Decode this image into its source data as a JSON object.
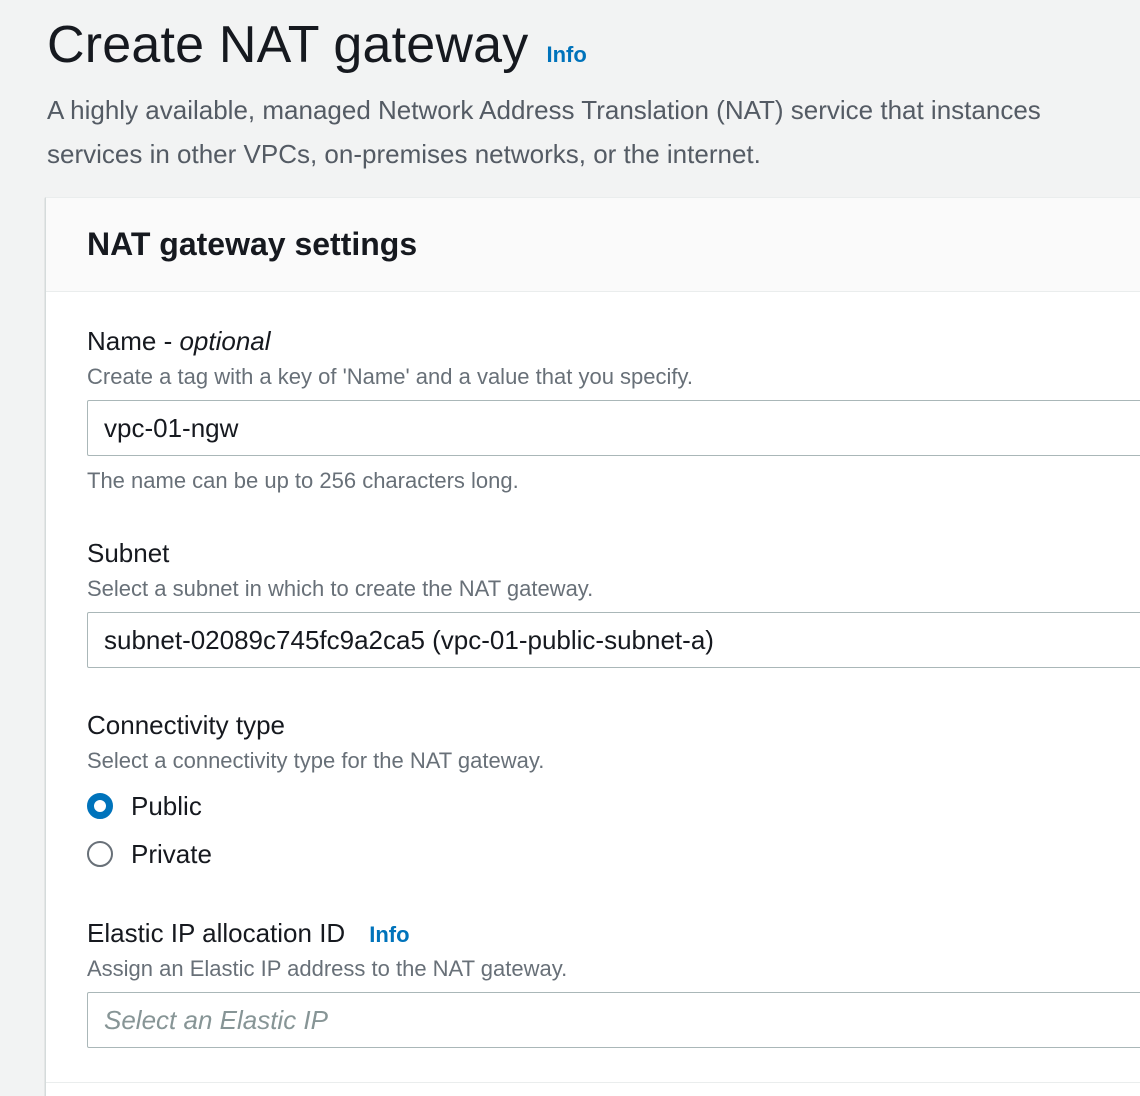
{
  "header": {
    "title": "Create NAT gateway",
    "info": "Info",
    "description_line1": "A highly available, managed Network Address Translation (NAT) service that instances",
    "description_line2": "services in other VPCs, on-premises networks, or the internet."
  },
  "panel": {
    "title": "NAT gateway settings"
  },
  "name_field": {
    "label": "Name - ",
    "label_optional": "optional",
    "description": "Create a tag with a key of 'Name' and a value that you specify.",
    "value": "vpc-01-ngw",
    "constraint": "The name can be up to 256 characters long."
  },
  "subnet_field": {
    "label": "Subnet",
    "description": "Select a subnet in which to create the NAT gateway.",
    "value": "subnet-02089c745fc9a2ca5 (vpc-01-public-subnet-a)"
  },
  "connectivity_field": {
    "label": "Connectivity type",
    "description": "Select a connectivity type for the NAT gateway.",
    "options": [
      {
        "label": "Public",
        "selected": true
      },
      {
        "label": "Private",
        "selected": false
      }
    ]
  },
  "eip_field": {
    "label": "Elastic IP allocation ID",
    "info": "Info",
    "description": "Assign an Elastic IP address to the NAT gateway.",
    "placeholder": "Select an Elastic IP"
  },
  "colors": {
    "link": "#0073bb",
    "radio_selected": "#0073bb",
    "page_background": "#f2f3f3"
  }
}
